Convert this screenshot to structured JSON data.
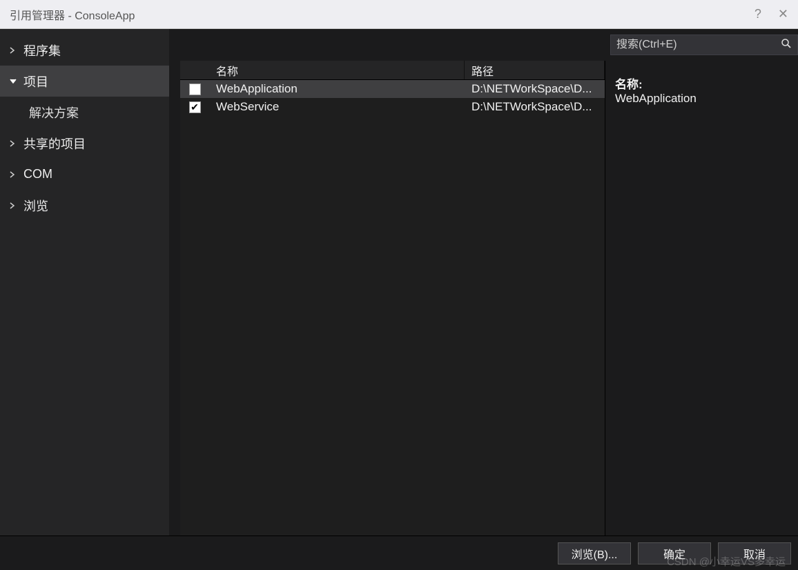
{
  "titlebar": {
    "title": "引用管理器 - ConsoleApp",
    "help": "?",
    "close": "✕"
  },
  "sidebar": {
    "items": [
      {
        "label": "程序集",
        "expanded": false,
        "selected": false
      },
      {
        "label": "项目",
        "expanded": true,
        "selected": true
      },
      {
        "label": "共享的项目",
        "expanded": false,
        "selected": false
      },
      {
        "label": "COM",
        "expanded": false,
        "selected": false
      },
      {
        "label": "浏览",
        "expanded": false,
        "selected": false
      }
    ],
    "subitems": [
      {
        "label": "解决方案"
      }
    ]
  },
  "search": {
    "placeholder": "搜索(Ctrl+E)"
  },
  "table": {
    "columns": {
      "name": "名称",
      "path": "路径"
    },
    "rows": [
      {
        "checked": false,
        "selected": true,
        "name": "WebApplication",
        "path": "D:\\NETWorkSpace\\D..."
      },
      {
        "checked": true,
        "selected": false,
        "name": "WebService",
        "path": "D:\\NETWorkSpace\\D..."
      }
    ]
  },
  "detail": {
    "label": "名称:",
    "value": "WebApplication"
  },
  "footer": {
    "browse": "浏览(B)...",
    "ok": "确定",
    "cancel": "取消"
  },
  "watermark": "CSDN @小幸运VS多幸运"
}
